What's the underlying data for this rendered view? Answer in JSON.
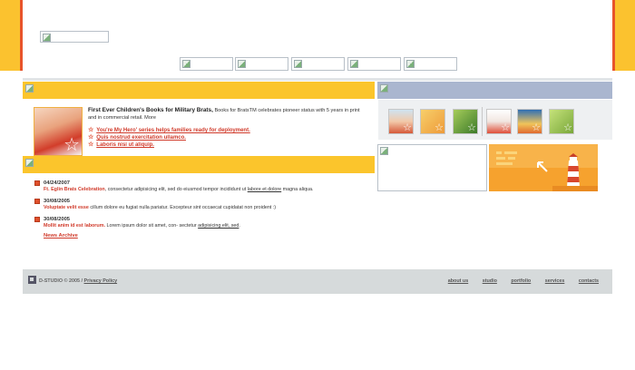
{
  "intro": {
    "title": "First Ever Children's Books for Military Brats,",
    "text": " Books for BratsTM celebrates pioneer status with 5 years in print and in commercial retail.",
    "more": " More"
  },
  "promos": [
    "You're My Hero' series helps families ready for deployment.",
    "Quis nostrud exercitation ullamco.",
    "Laboris nisi ut aliquip."
  ],
  "news": [
    {
      "date": "04/24/2007",
      "title": "Ft. Eglin Brats Celebration",
      "text": ", consectetur adipisicing elit, sed do eiusmod tempor incididunt ut ",
      "link": "labore et dolore",
      "tail": " magna aliqua."
    },
    {
      "date": "30/08/2005",
      "title": "Voluptate velit esse",
      "text": " cillum dolore eu fugiat nulla pariatur. Excepteur sint occaecat cupidatat non proident :)",
      "link": "",
      "tail": ""
    },
    {
      "date": "30/08/2005",
      "title": "Mollit anim id est laborum.",
      "text": " Lorem ipsum dolor sit amet, con- sectetur ",
      "link": "adipisicing elit, sed",
      "tail": "."
    }
  ],
  "archive": "News Archive",
  "footer": {
    "copyright": "D-STUDIO © 2005 / ",
    "privacy": "Privacy Policy",
    "nav": [
      "about us",
      "studio",
      "portfolio",
      "services",
      "contacts"
    ]
  },
  "colors": {
    "yellow": "#fbc52c",
    "orange": "#e8542a",
    "blue": "#aab6cf",
    "red_link": "#d03a2a"
  }
}
